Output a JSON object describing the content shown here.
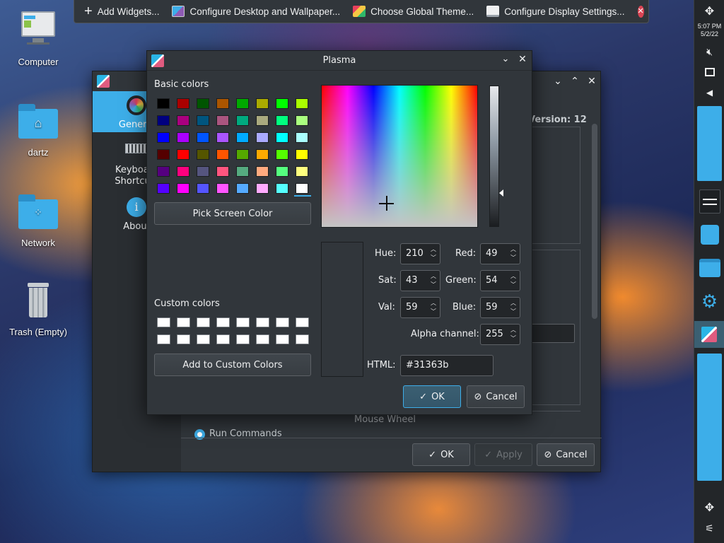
{
  "desktop": {
    "icons": [
      {
        "label": "Computer",
        "icon": "computer-icon"
      },
      {
        "label": "dartz",
        "icon": "home-folder-icon"
      },
      {
        "label": "Network",
        "icon": "network-folder-icon"
      },
      {
        "label": "Trash (Empty)",
        "icon": "trash-icon"
      }
    ]
  },
  "topbar": {
    "items": [
      {
        "label": "Add Widgets...",
        "icon": "plus-icon"
      },
      {
        "label": "Configure Desktop and Wallpaper...",
        "icon": "desktop-settings-icon"
      },
      {
        "label": "Choose Global Theme...",
        "icon": "theme-icon"
      },
      {
        "label": "Configure Display Settings...",
        "icon": "display-icon"
      }
    ]
  },
  "clock": {
    "time": "5:07 PM",
    "date": "5/2/22"
  },
  "settings_window": {
    "sidebar": [
      {
        "label": "General"
      },
      {
        "label": "Keyboard Shortcuts"
      },
      {
        "label": "About"
      }
    ],
    "version_label": "Version: 12",
    "mouse_wheel_label": "Mouse Wheel",
    "run_commands_label": "Run Commands",
    "buttons": {
      "ok": "OK",
      "apply": "Apply",
      "cancel": "Cancel"
    }
  },
  "dialog": {
    "title": "Plasma",
    "basic_colors_label": "Basic colors",
    "basic_colors": [
      [
        "#000000",
        "#aa0000",
        "#005500",
        "#aa5500",
        "#00aa00",
        "#aaaa00",
        "#00ff00",
        "#aaff00"
      ],
      [
        "#00007f",
        "#aa007f",
        "#00557f",
        "#aa557f",
        "#00aa7f",
        "#aaaa7f",
        "#00ff7f",
        "#aaff7f"
      ],
      [
        "#0000ff",
        "#aa00ff",
        "#0055ff",
        "#aa55ff",
        "#00aaff",
        "#aaaaff",
        "#00ffff",
        "#aaffff"
      ],
      [
        "#550000",
        "#ff0000",
        "#555500",
        "#ff5500",
        "#55aa00",
        "#ffaa00",
        "#55ff00",
        "#ffff00"
      ],
      [
        "#55007f",
        "#ff007f",
        "#55557f",
        "#ff557f",
        "#55aa7f",
        "#ffaa7f",
        "#55ff7f",
        "#ffff7f"
      ],
      [
        "#5500ff",
        "#ff00ff",
        "#5555ff",
        "#ff55ff",
        "#55aaff",
        "#ffaaff",
        "#55ffff",
        "#ffffff"
      ]
    ],
    "pick_screen_color": "Pick Screen Color",
    "custom_colors_label": "Custom colors",
    "add_to_custom": "Add to Custom Colors",
    "fields": {
      "hue": {
        "label": "Hue:",
        "value": "210"
      },
      "sat": {
        "label": "Sat:",
        "value": "43"
      },
      "val": {
        "label": "Val:",
        "value": "59"
      },
      "red": {
        "label": "Red:",
        "value": "49"
      },
      "green": {
        "label": "Green:",
        "value": "54"
      },
      "blue": {
        "label": "Blue:",
        "value": "59"
      },
      "alpha": {
        "label": "Alpha channel:",
        "value": "255"
      }
    },
    "html_label": "HTML:",
    "html_value": "#31363b",
    "ok": "OK",
    "cancel": "Cancel"
  }
}
